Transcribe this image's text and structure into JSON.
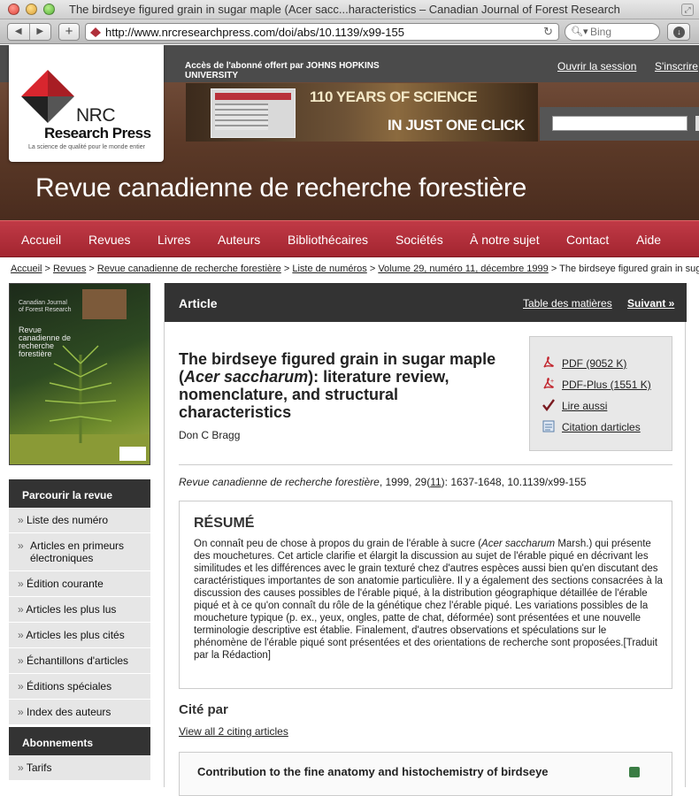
{
  "browser": {
    "window_title": "The birdseye figured grain in sugar maple (Acer sacc...haracteristics – Canadian Journal of Forest Research",
    "url": "http://www.nrcresearchpress.com/doi/abs/10.1139/x99-155",
    "search_placeholder": "Bing"
  },
  "header": {
    "access_text": "Accès de l'abonné offert par JOHNS HOPKINS UNIVERSITY",
    "login": "Ouvrir la session",
    "signup": "S'inscrire",
    "banner_line1": "110 YEARS OF SCIENCE",
    "banner_line2": "IN JUST ONE CLICK",
    "logo_nrc": "NRC",
    "logo_name": "Research Press",
    "logo_tagline": "La science de qualité pour le monde entier",
    "journal_title": "Revue canadienne de recherche forestière"
  },
  "nav": [
    "Accueil",
    "Revues",
    "Livres",
    "Auteurs",
    "Bibliothécaires",
    "Sociétés",
    "À notre sujet",
    "Contact",
    "Aide"
  ],
  "breadcrumb": {
    "items": [
      "Accueil",
      "Revues",
      "Revue canadienne de recherche forestière",
      "Liste de numéros",
      "Volume 29, numéro 11, décembre 1999"
    ],
    "current": "The birdseye figured grain in suga",
    "separator": ">"
  },
  "cover": {
    "title_en": "Canadian Journal of Forest Research",
    "title_fr": "Revue canadienne de recherche forestière"
  },
  "sidebar": {
    "browse_heading": "Parcourir la revue",
    "browse_items": [
      "Liste des numéro",
      "Articles en primeurs électroniques",
      "Édition courante",
      "Articles les plus lus",
      "Articles les plus cités",
      "Échantillons d'articles",
      "Éditions spéciales",
      "Index des auteurs"
    ],
    "subs_heading": "Abonnements",
    "subs_items": [
      "Tarifs"
    ],
    "arrow": "»"
  },
  "article": {
    "bar_label": "Article",
    "toc": "Table des matières",
    "next": "Suivant »",
    "title_parts": [
      "The birdseye figured grain in sugar maple (",
      "Acer saccharum",
      "): literature review, nomenclature, and structural characteristics"
    ],
    "author": "Don C Bragg",
    "citation_journal": "Revue canadienne de recherche forestière",
    "citation_mid": ", 1999, 29(",
    "citation_issue": "11",
    "citation_end": "): 1637-1648, 10.1139/x99-155",
    "tools": [
      {
        "label": "PDF (9052 K)",
        "icon": "pdf-icon"
      },
      {
        "label": "PDF-Plus (1551 K)",
        "icon": "pdf-plus-icon"
      },
      {
        "label": "Lire aussi",
        "icon": "checkmark-icon"
      },
      {
        "label": "Citation darticles",
        "icon": "citation-icon"
      }
    ],
    "abstract_heading": "RÉSUMÉ",
    "abstract_pre": "On connaît peu de chose à propos du grain de l'érable à sucre (",
    "abstract_italic": "Acer saccharum",
    "abstract_post": " Marsh.) qui présente des mouchetures. Cet article clarifie et élargit la discussion au sujet de l'érable piqué en décrivant les similitudes et les différences avec le grain texturé chez d'autres espèces aussi bien qu'en discutant des caractéristiques importantes de son anatomie particulière. Il y a également des sections consacrées à la discussion des causes possibles de l'érable piqué, à la distribution géographique détaillée de l'érable piqué et à ce qu'on connaît du rôle de la génétique chez l'érable piqué. Les variations possibles de la moucheture typique (p. ex., yeux, ongles, patte de chat, déformée) sont présentées et une nouvelle terminologie descriptive est établie. Finalement, d'autres observations et spéculations sur le phénomène de l'érable piqué sont présentées et des orientations de recherche sont proposées.[Traduit par la Rédaction]",
    "cited_by_heading": "Cité par",
    "cited_by_link": "View all 2 citing articles",
    "cited_item_title": "Contribution to the fine anatomy and histochemistry of birdseye"
  },
  "colors": {
    "nav_red": "#b02f3a",
    "header_brown": "#5c3a28",
    "dark_bar": "#333333"
  }
}
